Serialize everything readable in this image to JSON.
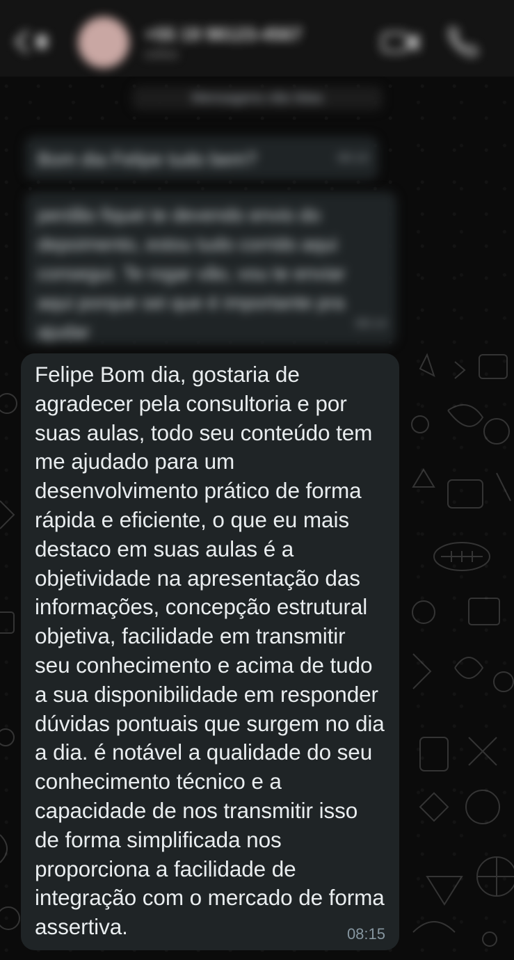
{
  "header": {
    "contact_name": "+55 19 98123-4567",
    "contact_status": "online"
  },
  "chat": {
    "banner": "Mensagens não lidas",
    "previous_messages": [
      {
        "text": "Bom dia Felipe tudo bem?",
        "time": "08:10"
      },
      {
        "text": "perdão fiquei te devendo envio do depoimento, estou tudo corrido aqui consegui. Te rogar vão, vou te enviar aqui porque sei que é importante pra ajudar",
        "time": "08:14"
      }
    ],
    "message": {
      "text": "Felipe Bom dia, gostaria de agradecer pela consultoria e por suas aulas, todo seu conteúdo tem me ajudado para um desenvolvimento prático de forma rápida e eficiente, o que eu mais destaco em suas aulas é a objetividade na apresentação das informações, concepção estrutural objetiva, facilidade em transmitir seu conhecimento e acima de tudo a sua disponibilidade em responder dúvidas pontuais que surgem no dia a dia. é notável a qualidade do seu conhecimento técnico e a capacidade de nos transmitir isso de forma simplificada nos proporciona a facilidade de integração com o mercado de forma assertiva.",
      "time": "08:15"
    }
  },
  "colors": {
    "background": "#0b0b0b",
    "bubble": "#1f2426",
    "text": "#e9edef",
    "timestamp": "#8696a0"
  },
  "icons": [
    "back-arrow-icon",
    "video-call-icon",
    "phone-icon",
    "doodle-pattern-icon"
  ]
}
